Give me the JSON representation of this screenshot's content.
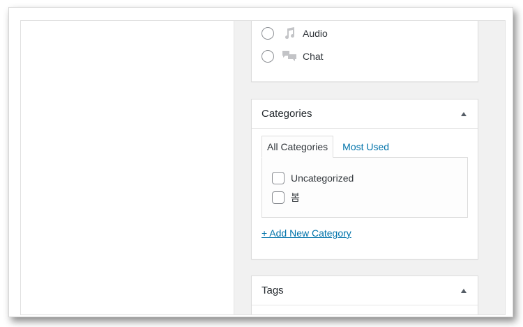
{
  "post_format": {
    "options": [
      {
        "label": "Audio",
        "icon": "music-note-icon",
        "selected": false
      },
      {
        "label": "Chat",
        "icon": "chat-bubbles-icon",
        "selected": false
      }
    ]
  },
  "categories_box": {
    "title": "Categories",
    "tabs": [
      {
        "label": "All Categories",
        "active": true
      },
      {
        "label": "Most Used",
        "active": false
      }
    ],
    "items": [
      {
        "label": "Uncategorized",
        "checked": false
      },
      {
        "label": "봄",
        "checked": false
      }
    ],
    "add_new_link": "+ Add New Category"
  },
  "tags_box": {
    "title": "Tags"
  },
  "colors": {
    "link": "#0073aa",
    "sidebar_bg": "#f1f1f1",
    "icon_gray": "#c3c4c7"
  }
}
